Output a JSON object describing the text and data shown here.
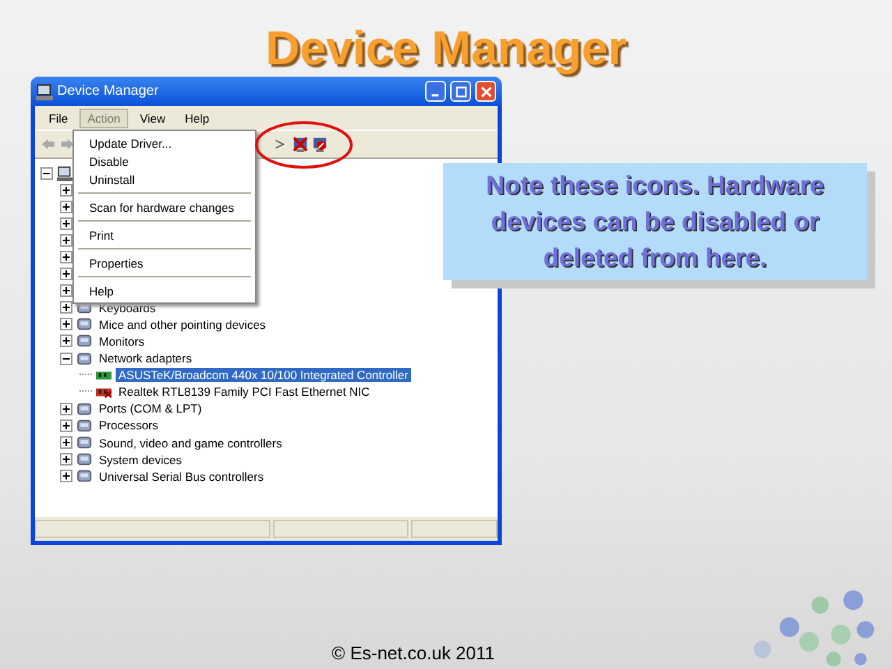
{
  "slide_title": "Device Manager",
  "window": {
    "title": "Device Manager",
    "menus": [
      {
        "label": "File",
        "selected": false
      },
      {
        "label": "Action",
        "selected": true
      },
      {
        "label": "View",
        "selected": false
      },
      {
        "label": "Help",
        "selected": false
      }
    ],
    "open_menu": [
      {
        "kind": "item",
        "label": "Update Driver..."
      },
      {
        "kind": "item",
        "label": "Disable"
      },
      {
        "kind": "item",
        "label": "Uninstall"
      },
      {
        "kind": "separator"
      },
      {
        "kind": "item",
        "label": "Scan for hardware changes"
      },
      {
        "kind": "separator"
      },
      {
        "kind": "item",
        "label": "Print"
      },
      {
        "kind": "separator"
      },
      {
        "kind": "item",
        "label": "Properties"
      },
      {
        "kind": "separator"
      },
      {
        "kind": "item",
        "label": "Help"
      }
    ],
    "tree": [
      {
        "expanded": true,
        "children": [
          {
            "expanded": false
          },
          {
            "expanded": false
          },
          {
            "expanded": false
          },
          {
            "expanded": false
          },
          {
            "expanded": false
          },
          {
            "expanded": false
          },
          {
            "expanded": false
          },
          {
            "label": "Keyboards",
            "expanded": false
          },
          {
            "label": "Mice and other pointing devices",
            "expanded": false
          },
          {
            "label": "Monitors",
            "expanded": false
          },
          {
            "label": "Network adapters",
            "expanded": true,
            "children": [
              {
                "label": "ASUSTeK/Broadcom 440x 10/100 Integrated Controller",
                "selected": true,
                "disabled": false
              },
              {
                "label": "Realtek RTL8139 Family PCI Fast Ethernet NIC",
                "selected": false,
                "disabled": true
              }
            ]
          },
          {
            "label": "Ports (COM & LPT)",
            "expanded": false
          },
          {
            "label": "Processors",
            "expanded": false
          },
          {
            "label": "Sound, video and game controllers",
            "expanded": false
          },
          {
            "label": "System devices",
            "expanded": false
          },
          {
            "label": "Universal Serial Bus controllers",
            "expanded": false
          }
        ]
      }
    ]
  },
  "callout": "Note these icons. Hardware devices can be disabled or deleted from here.",
  "footer": "© Es-net.co.uk 2011"
}
